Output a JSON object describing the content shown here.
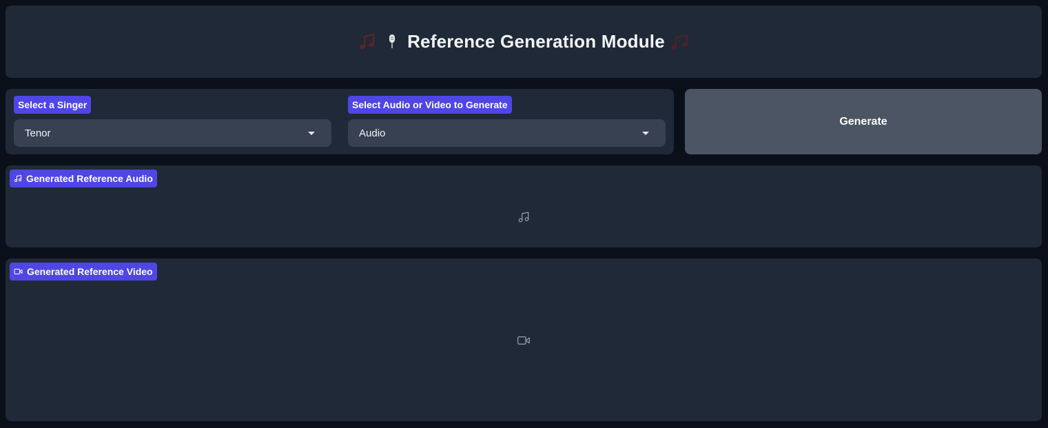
{
  "header": {
    "title": "Reference Generation Module",
    "left_icons": [
      "music-note-icon",
      "microphone-icon"
    ],
    "right_icon": "music-notes-icon"
  },
  "controls": {
    "singer": {
      "label": "Select a Singer",
      "value": "Tenor"
    },
    "media_type": {
      "label": "Select Audio or Video to Generate",
      "value": "Audio"
    },
    "generate_label": "Generate"
  },
  "outputs": {
    "audio": {
      "label": "Generated Reference Audio",
      "icon": "music-icon"
    },
    "video": {
      "label": "Generated Reference Video",
      "icon": "video-camera-icon"
    }
  },
  "colors": {
    "background": "#0b0f19",
    "panel": "#1f2937",
    "accent": "#4f46e5",
    "dropdown": "#374151",
    "button": "#4b5563",
    "emoji_red": "#6b2a2a"
  }
}
